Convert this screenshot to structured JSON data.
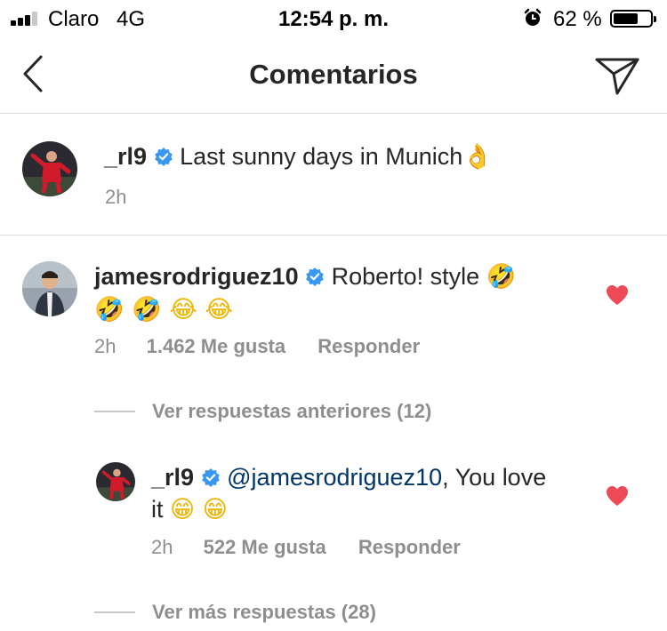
{
  "status_bar": {
    "carrier": "Claro",
    "network": "4G",
    "time": "12:54 p. m.",
    "battery_percent": "62 %"
  },
  "nav": {
    "title": "Comentarios"
  },
  "caption": {
    "username": "_rl9",
    "text": "Last sunny days in Munich",
    "emoji": "👌",
    "time": "2h"
  },
  "comments": [
    {
      "username": "jamesrodriguez10",
      "text": "Roberto! style",
      "emoji_1": "🤣",
      "emoji_line": "🤣 🤣 😂 😂",
      "time": "2h",
      "likes": "1.462 Me gusta",
      "reply_label": "Responder",
      "view_replies": "Ver respuestas anteriores (12)"
    }
  ],
  "reply": {
    "username": "_rl9",
    "mention": "@jamesrodriguez10",
    "text_1": ", You love",
    "text_2": "it",
    "emoji": "😁 😁",
    "time": "2h",
    "likes": "522 Me gusta",
    "reply_label": "Responder",
    "view_more": "Ver más respuestas (28)"
  },
  "colors": {
    "heart": "#ed4956",
    "verified": "#3897f0",
    "mention": "#003569",
    "muted": "#8e8e8e"
  },
  "icons": [
    "signal-icon",
    "alarm-icon",
    "battery-icon",
    "back-arrow-icon",
    "send-icon",
    "verified-badge-icon",
    "heart-icon"
  ]
}
